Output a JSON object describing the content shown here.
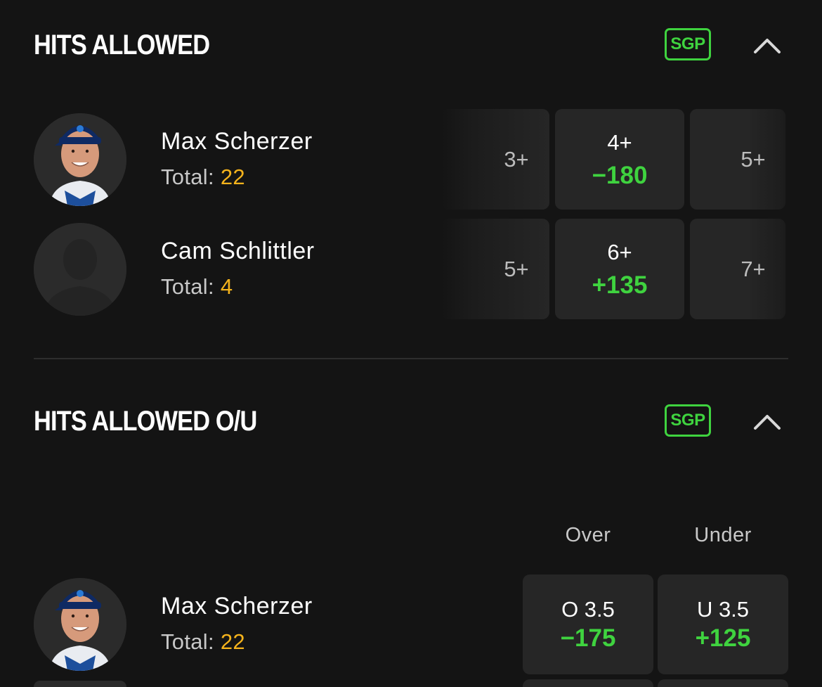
{
  "sections": [
    {
      "title": "HITS ALLOWED",
      "badge": "SGP",
      "rows": [
        {
          "player": "Max Scherzer",
          "total_label": "Total:",
          "total_value": "22",
          "options": [
            {
              "line": "3+"
            },
            {
              "line": "4+",
              "odds": "−180"
            },
            {
              "line": "5+"
            }
          ]
        },
        {
          "player": "Cam Schlittler",
          "total_label": "Total:",
          "total_value": "4",
          "options": [
            {
              "line": "5+"
            },
            {
              "line": "6+",
              "odds": "+135"
            },
            {
              "line": "7+"
            }
          ]
        }
      ]
    },
    {
      "title": "HITS ALLOWED O/U",
      "badge": "SGP",
      "columns": [
        "Over",
        "Under"
      ],
      "rows": [
        {
          "player": "Max Scherzer",
          "total_label": "Total:",
          "total_value": "22",
          "over": {
            "line": "O 3.5",
            "odds": "−175"
          },
          "under": {
            "line": "U 3.5",
            "odds": "+125"
          }
        }
      ]
    }
  ],
  "icons": {
    "collapse": "chevron-up-icon",
    "avatar_photo": "player-photo",
    "avatar_placeholder": "person-silhouette-icon"
  },
  "colors": {
    "background": "#141414",
    "accent_green": "#3fd33f",
    "total_yellow": "#f5b31c",
    "cell": "#262626"
  }
}
